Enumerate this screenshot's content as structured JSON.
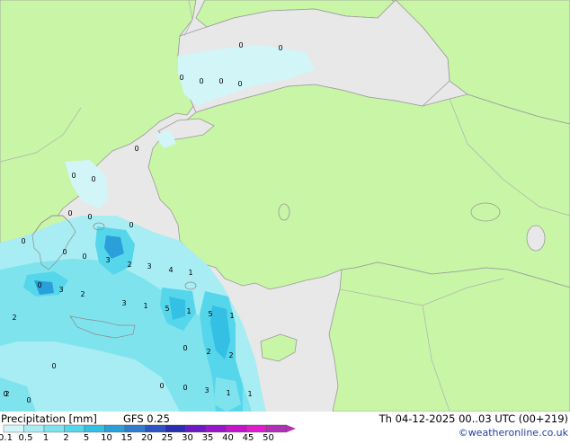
{
  "title": "Precipitation [mm]",
  "model": "GFS 0.25",
  "valid_time": "Th 04-12-2025 00..03 UTC (00+219)",
  "credit": "©weatheronline.co.uk",
  "legend": {
    "levels": [
      "0.1",
      "0.5",
      "1",
      "2",
      "5",
      "10",
      "15",
      "20",
      "25",
      "30",
      "35",
      "40",
      "45",
      "50"
    ],
    "colors": [
      "#d2f5f8",
      "#a8edf3",
      "#7fe3ee",
      "#55d6ea",
      "#33c0e4",
      "#2b9fd9",
      "#2f7cd0",
      "#2e54c4",
      "#2a2fb0",
      "#6a1bc4",
      "#9b16c9",
      "#c315c9",
      "#e01bd0",
      "#b030b8"
    ]
  },
  "map_colors": {
    "land": "#c8f5a6",
    "sea": "#e8e8e8",
    "coast": "#9a9a9a"
  },
  "precip_labels": [
    "0",
    "0",
    "0",
    "0",
    "0",
    "0",
    "0",
    "0",
    "0",
    "0",
    "0",
    "0",
    "0",
    "0",
    "0",
    "3",
    "2",
    "3",
    "4",
    "1",
    "0",
    "3",
    "2",
    "3",
    "1",
    "5",
    "1",
    "5",
    "1",
    "2",
    "0",
    "2",
    "2",
    "0",
    "0",
    "0",
    "3",
    "1",
    "1",
    "0",
    "0",
    "2"
  ]
}
